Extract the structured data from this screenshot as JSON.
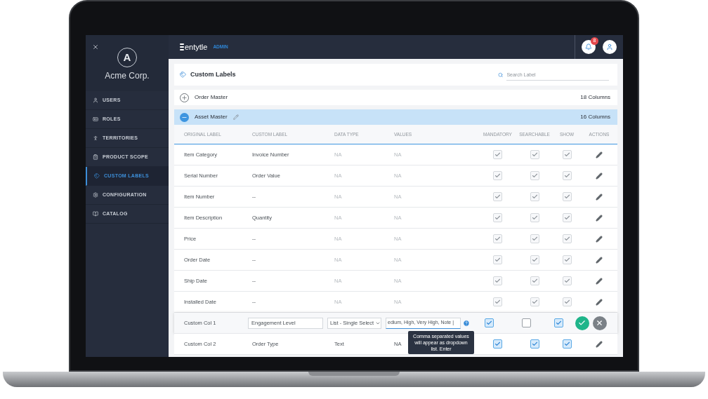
{
  "sidebar": {
    "avatar_letter": "A",
    "company": "Acme Corp.",
    "items": [
      {
        "label": "USERS",
        "selected": false
      },
      {
        "label": "ROLES",
        "selected": false
      },
      {
        "label": "TERRITORIES",
        "selected": false
      },
      {
        "label": "PRODUCT SCOPE",
        "selected": false
      },
      {
        "label": "CUSTOM LABELS",
        "selected": true
      },
      {
        "label": "CONFIGURATION",
        "selected": false
      },
      {
        "label": "CATALOG",
        "selected": false
      }
    ]
  },
  "header": {
    "logo": "entytle",
    "badge": "ADMIN",
    "notification_count": "8"
  },
  "page": {
    "title": "Custom Labels",
    "search": {
      "placeholder": "Search Label"
    }
  },
  "groups": [
    {
      "name": "Order Master",
      "count": "18 Columns",
      "expanded": false
    },
    {
      "name": "Asset Master",
      "count": "16 Columns",
      "expanded": true
    }
  ],
  "table": {
    "columns": [
      "ORIGINAL LABEL",
      "CUSTOM LABEL",
      "DATA TYPE",
      "VALUES",
      "MANDATORY",
      "SEARCHABLE",
      "SHOW",
      "ACTIONS"
    ],
    "rows": [
      {
        "kind": "view",
        "original": "Item Category",
        "custom": "Invoice Number",
        "data_type": "NA",
        "values": "NA",
        "mandatory": true,
        "searchable": true,
        "show": true,
        "disabled": true
      },
      {
        "kind": "view",
        "original": "Serial Number",
        "custom": "Order Value",
        "data_type": "NA",
        "values": "NA",
        "mandatory": true,
        "searchable": true,
        "show": true,
        "disabled": true
      },
      {
        "kind": "view",
        "original": "Item Number",
        "custom": "--",
        "data_type": "NA",
        "values": "NA",
        "mandatory": true,
        "searchable": true,
        "show": true,
        "disabled": true
      },
      {
        "kind": "view",
        "original": "Item Description",
        "custom": "Quantity",
        "data_type": "NA",
        "values": "NA",
        "mandatory": true,
        "searchable": true,
        "show": true,
        "disabled": true
      },
      {
        "kind": "view",
        "original": "Price",
        "custom": "--",
        "data_type": "NA",
        "values": "NA",
        "mandatory": true,
        "searchable": true,
        "show": true,
        "disabled": true
      },
      {
        "kind": "view",
        "original": "Order Date",
        "custom": "--",
        "data_type": "NA",
        "values": "NA",
        "mandatory": true,
        "searchable": true,
        "show": true,
        "disabled": true
      },
      {
        "kind": "view",
        "original": "Ship Date",
        "custom": "--",
        "data_type": "NA",
        "values": "NA",
        "mandatory": true,
        "searchable": true,
        "show": true,
        "disabled": true
      },
      {
        "kind": "view",
        "original": "Installed Date",
        "custom": "--",
        "data_type": "NA",
        "values": "NA",
        "mandatory": true,
        "searchable": true,
        "show": true,
        "disabled": true
      },
      {
        "kind": "edit",
        "original": "Custom Col 1",
        "custom": "Engagement Level",
        "data_type": "List - Single Select",
        "values": "edium, High, Very High, Note |",
        "mandatory": true,
        "searchable": false,
        "show": true,
        "disabled": false,
        "tooltip": "Comma separated values will appear as dropdown list. Enter"
      },
      {
        "kind": "view",
        "original": "Custom Col 2",
        "custom": "Order Type",
        "data_type": "Text",
        "values": "NA",
        "mandatory": true,
        "searchable": true,
        "show": true,
        "disabled": false
      }
    ]
  }
}
